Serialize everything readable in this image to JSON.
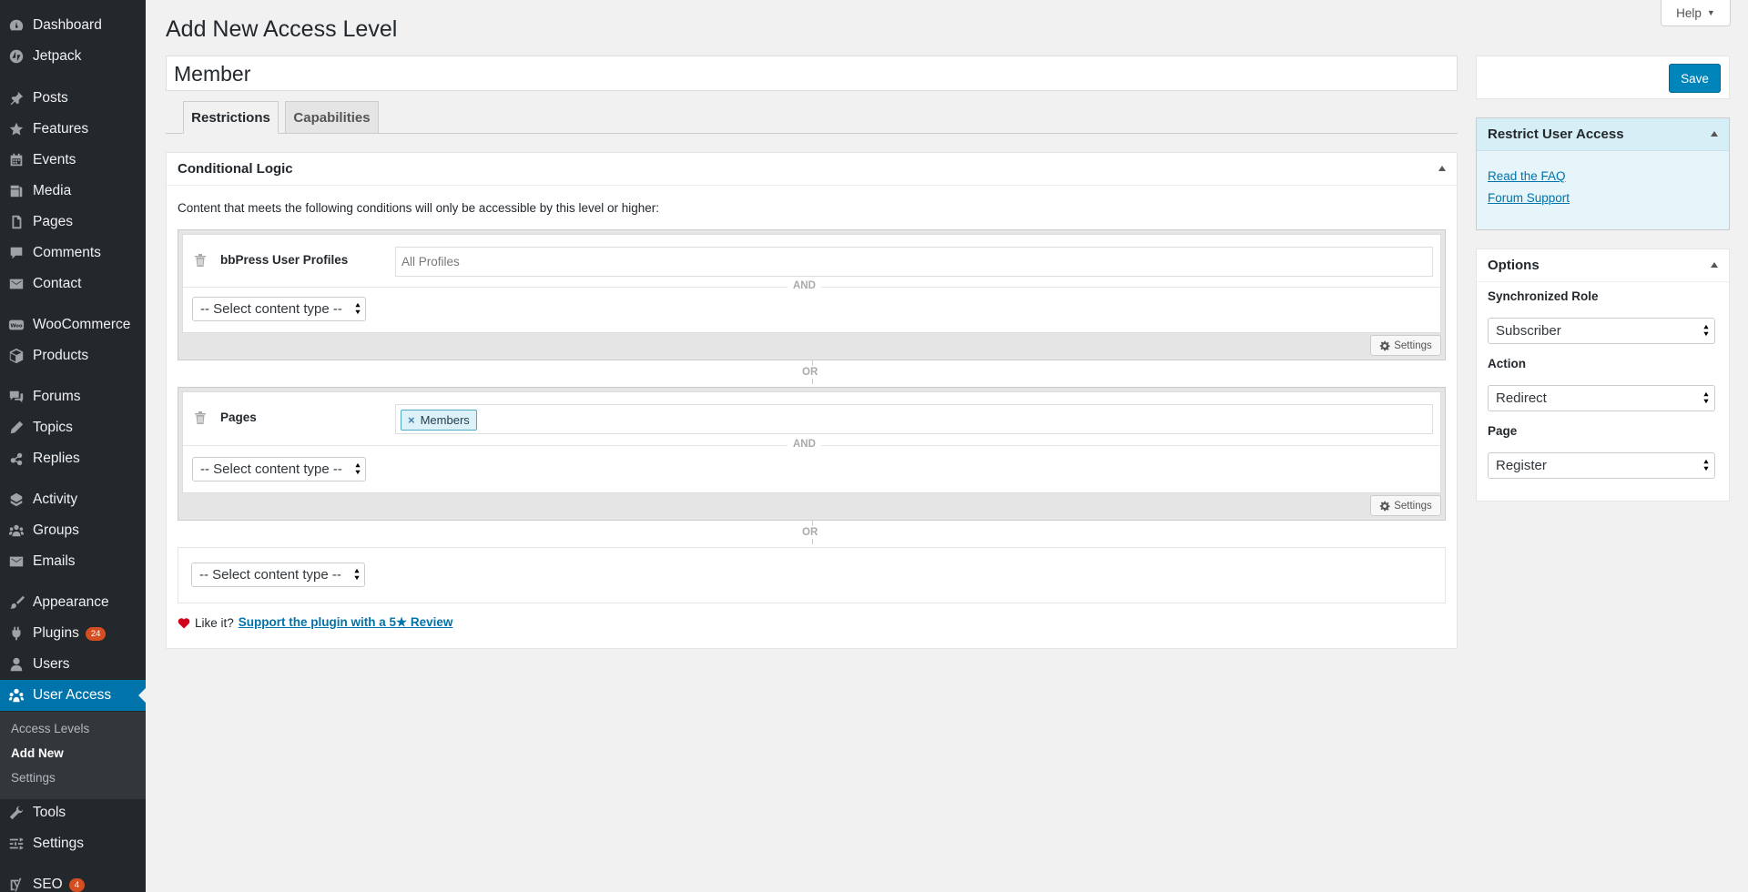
{
  "sidebar": {
    "items": [
      {
        "label": "Dashboard",
        "icon": "dashboard-icon"
      },
      {
        "label": "Jetpack",
        "icon": "jetpack-icon"
      },
      {
        "label": "Posts",
        "icon": "pushpin-icon"
      },
      {
        "label": "Features",
        "icon": "star-icon"
      },
      {
        "label": "Events",
        "icon": "calendar-icon"
      },
      {
        "label": "Media",
        "icon": "media-icon"
      },
      {
        "label": "Pages",
        "icon": "page-icon"
      },
      {
        "label": "Comments",
        "icon": "comment-icon"
      },
      {
        "label": "Contact",
        "icon": "mail-icon"
      },
      {
        "label": "WooCommerce",
        "icon": "woocommerce-icon"
      },
      {
        "label": "Products",
        "icon": "products-icon"
      },
      {
        "label": "Forums",
        "icon": "forums-icon"
      },
      {
        "label": "Topics",
        "icon": "topics-icon"
      },
      {
        "label": "Replies",
        "icon": "replies-icon"
      },
      {
        "label": "Activity",
        "icon": "activity-icon"
      },
      {
        "label": "Groups",
        "icon": "groups-icon"
      },
      {
        "label": "Emails",
        "icon": "mail-icon"
      },
      {
        "label": "Appearance",
        "icon": "brush-icon"
      },
      {
        "label": "Plugins",
        "icon": "plugin-icon",
        "badge": "24"
      },
      {
        "label": "Users",
        "icon": "user-icon"
      },
      {
        "label": "User Access",
        "icon": "user-access-icon"
      },
      {
        "label": "Tools",
        "icon": "wrench-icon"
      },
      {
        "label": "Settings",
        "icon": "settings-icon"
      },
      {
        "label": "SEO",
        "icon": "yoast-icon",
        "badge": "4"
      }
    ],
    "submenu": [
      "Access Levels",
      "Add New",
      "Settings"
    ]
  },
  "page": {
    "title": "Add New Access Level",
    "help_label": "Help",
    "level_name": "Member"
  },
  "tabs": [
    "Restrictions",
    "Capabilities"
  ],
  "conditional": {
    "header": "Conditional Logic",
    "description": "Content that meets the following conditions will only be accessible by this level or higher:",
    "group1": {
      "label": "bbPress User Profiles",
      "value": "All Profiles"
    },
    "group2": {
      "label": "Pages",
      "tag": "Members"
    },
    "and_label": "AND",
    "or_label": "OR",
    "select_placeholder": "-- Select content type --",
    "settings_label": "Settings",
    "footer_like": "Like it?",
    "footer_link": "Support the plugin with a 5★ Review"
  },
  "save_label": "Save",
  "rua": {
    "header": "Restrict User Access",
    "faq": "Read the FAQ",
    "support": "Forum Support"
  },
  "options": {
    "header": "Options",
    "synced_role_label": "Synchronized Role",
    "synced_role_value": "Subscriber",
    "action_label": "Action",
    "action_value": "Redirect",
    "page_label": "Page",
    "page_value": "Register"
  },
  "colors": {
    "sidebar_bg": "#23282d",
    "accent": "#0073aa",
    "save_button": "#0085ba",
    "badge": "#d54e21"
  }
}
